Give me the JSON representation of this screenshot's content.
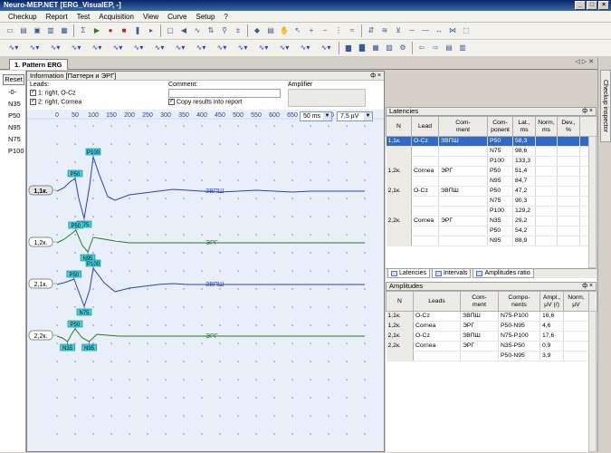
{
  "window": {
    "title": "Neuro-MEP.NET [ERG_VisualEP, -]",
    "min_glyph": "_",
    "max_glyph": "□",
    "close_glyph": "×"
  },
  "menu": [
    {
      "label": "Checkup"
    },
    {
      "label": "Report"
    },
    {
      "label": "Test"
    },
    {
      "label": "Acquisition"
    },
    {
      "label": "View"
    },
    {
      "label": "Curve"
    },
    {
      "label": "Setup"
    },
    {
      "label": "?"
    }
  ],
  "toolbar1_icons": [
    "new-icon",
    "open-icon",
    "save-icon",
    "print-icon",
    "preview-icon",
    "sigma-icon",
    "play-icon",
    "record-icon",
    "stop-icon",
    "pause-icon",
    "step-icon",
    "monitor-icon",
    "speaker-icon",
    "wave-icon",
    "arrows-icon",
    "search-icon",
    "gain-icon",
    "marker-icon",
    "lock-icon",
    "hand-icon",
    "cursor-icon",
    "zoom-in-icon",
    "zoom-out-icon",
    "split-icon",
    "average-icon",
    "invert-icon",
    "overlay-icon",
    "filter-icon",
    "smooth-icon",
    "baseline-icon",
    "shift-icon",
    "align-icon",
    "select-icon"
  ],
  "toolbar2_icons": [
    "curve1-icon",
    "curve2-icon",
    "curve3-icon",
    "curve4-icon",
    "curve5-icon",
    "curve6-icon",
    "curve7-icon",
    "curve8-icon",
    "curve9-icon",
    "curve10-icon",
    "curve11-icon",
    "curve12-icon",
    "curve13-icon",
    "curve14-icon",
    "curve15-icon",
    "curve16-icon",
    "histogram-icon",
    "bar-chart-icon",
    "table-icon",
    "photo-icon",
    "settings-icon",
    "back-icon",
    "forward-icon",
    "doc-icon",
    "report-icon"
  ],
  "doc_tab": {
    "label": "1. Pattern ERG",
    "controls": "◁ ▷ ✕"
  },
  "side_label": "Checkup inspector",
  "left": {
    "reset": "Reset",
    "rows": [
      "-0-",
      "N35",
      "P50",
      "N95",
      "N75",
      "P100"
    ]
  },
  "info": {
    "header": "Information [Паттерн и ЭРГ]",
    "pin": "ф ×",
    "leads_label": "Leads:",
    "leads": [
      {
        "text": "1: right, O-Cz",
        "checked": "✓"
      },
      {
        "text": "2: right, Cornea",
        "checked": "✓"
      }
    ],
    "comment_label": "Comment:",
    "copy_results": "Copy results into report",
    "copy_checked": "✓",
    "amplifier_label": "Amplifier"
  },
  "chart": {
    "time_scale": "50 ms",
    "amp_scale": "7,5 µV",
    "x_ticks": [
      0,
      50,
      100,
      150,
      200,
      250,
      300,
      350,
      400,
      450,
      500,
      550,
      600,
      650,
      700,
      750,
      800,
      850
    ],
    "traces": [
      {
        "tag": "1,1к.",
        "label": "ЗВПШ",
        "color": "#2a3fc0",
        "points": [
          [
            0,
            0
          ],
          [
            20,
            -4
          ],
          [
            35,
            -10
          ],
          [
            50,
            -14
          ],
          [
            60,
            8
          ],
          [
            75,
            30
          ],
          [
            90,
            -6
          ],
          [
            100,
            -38
          ],
          [
            115,
            -20
          ],
          [
            140,
            6
          ],
          [
            160,
            10
          ],
          [
            200,
            4
          ],
          [
            240,
            2
          ],
          [
            280,
            0
          ],
          [
            320,
            -2
          ],
          [
            360,
            -1
          ],
          [
            400,
            0
          ],
          [
            450,
            1
          ],
          [
            500,
            0
          ],
          [
            550,
            -1
          ],
          [
            600,
            0
          ],
          [
            650,
            1
          ],
          [
            700,
            0
          ],
          [
            750,
            0
          ],
          [
            800,
            0
          ],
          [
            850,
            0
          ]
        ],
        "markers": [
          {
            "name": "P50",
            "t": 50,
            "v": -14
          },
          {
            "name": "N75",
            "t": 75,
            "v": 30
          },
          {
            "name": "P100",
            "t": 100,
            "v": -38
          }
        ]
      },
      {
        "tag": "1,2к.",
        "label": "ЭРГ",
        "color": "#2a7a2a",
        "points": [
          [
            0,
            0
          ],
          [
            20,
            -4
          ],
          [
            40,
            -10
          ],
          [
            52,
            -14
          ],
          [
            70,
            3
          ],
          [
            85,
            10
          ],
          [
            100,
            -6
          ],
          [
            130,
            -4
          ],
          [
            160,
            -2
          ],
          [
            200,
            0
          ],
          [
            250,
            0
          ],
          [
            300,
            0
          ],
          [
            350,
            0
          ],
          [
            400,
            0
          ],
          [
            450,
            0
          ],
          [
            500,
            0
          ],
          [
            550,
            0
          ],
          [
            600,
            0
          ],
          [
            650,
            0
          ],
          [
            700,
            0
          ],
          [
            750,
            0
          ],
          [
            800,
            0
          ],
          [
            850,
            0
          ]
        ],
        "markers": [
          {
            "name": "P50",
            "t": 52,
            "v": -14
          },
          {
            "name": "N95",
            "t": 85,
            "v": 10
          }
        ]
      },
      {
        "tag": "2,1к.",
        "label": "ЗВПШ",
        "color": "#2a3fc0",
        "points": [
          [
            0,
            0
          ],
          [
            20,
            -2
          ],
          [
            35,
            -4
          ],
          [
            47,
            -6
          ],
          [
            60,
            8
          ],
          [
            75,
            24
          ],
          [
            90,
            6
          ],
          [
            100,
            -18
          ],
          [
            130,
            -2
          ],
          [
            160,
            8
          ],
          [
            200,
            4
          ],
          [
            240,
            2
          ],
          [
            280,
            0
          ],
          [
            320,
            -1
          ],
          [
            360,
            0
          ],
          [
            400,
            0
          ],
          [
            450,
            0
          ],
          [
            500,
            0
          ],
          [
            550,
            0
          ],
          [
            600,
            0
          ],
          [
            650,
            0
          ],
          [
            700,
            0
          ],
          [
            750,
            0
          ],
          [
            800,
            0
          ],
          [
            850,
            0
          ]
        ],
        "markers": [
          {
            "name": "P50",
            "t": 47,
            "v": -6
          },
          {
            "name": "N75",
            "t": 75,
            "v": 24
          },
          {
            "name": "P100",
            "t": 100,
            "v": -18
          }
        ]
      },
      {
        "tag": "2,2к.",
        "label": "ЭРГ",
        "color": "#2a7a2a",
        "points": [
          [
            0,
            0
          ],
          [
            15,
            2
          ],
          [
            29,
            6
          ],
          [
            40,
            -2
          ],
          [
            50,
            -8
          ],
          [
            70,
            2
          ],
          [
            89,
            6
          ],
          [
            110,
            -2
          ],
          [
            140,
            -1
          ],
          [
            170,
            0
          ],
          [
            200,
            0
          ],
          [
            250,
            0
          ],
          [
            300,
            0
          ],
          [
            350,
            0
          ],
          [
            400,
            0
          ],
          [
            450,
            0
          ],
          [
            500,
            0
          ],
          [
            550,
            0
          ],
          [
            600,
            0
          ],
          [
            650,
            0
          ],
          [
            700,
            0
          ],
          [
            750,
            0
          ],
          [
            800,
            0
          ],
          [
            850,
            0
          ]
        ],
        "markers": [
          {
            "name": "N35",
            "t": 29,
            "v": 6
          },
          {
            "name": "P50",
            "t": 50,
            "v": -8
          },
          {
            "name": "N95",
            "t": 89,
            "v": 6
          }
        ]
      }
    ]
  },
  "latencies": {
    "title": "Latencies",
    "pin": "ф ×",
    "headers": [
      "N",
      "Lead",
      "Com-\nment",
      "Com-\nponent",
      "Lat.,\nms",
      "Norm,\nms",
      "Dev.,\n%"
    ],
    "rows": [
      [
        "1,1к.",
        "O-Cz",
        "ЗВПШ",
        "P50",
        "58,3",
        "",
        ""
      ],
      [
        "",
        "",
        "",
        "N75",
        "98,6",
        "",
        ""
      ],
      [
        "",
        "",
        "",
        "P100",
        "133,3",
        "",
        ""
      ],
      [
        "1,2к.",
        "Cornea",
        "ЭРГ",
        "P50",
        "51,4",
        "",
        ""
      ],
      [
        "",
        "",
        "",
        "N95",
        "84,7",
        "",
        ""
      ],
      [
        "2,1к.",
        "O-Cz",
        "ЗВПШ",
        "P50",
        "47,2",
        "",
        ""
      ],
      [
        "",
        "",
        "",
        "N75",
        "90,3",
        "",
        ""
      ],
      [
        "",
        "",
        "",
        "P100",
        "129,2",
        "",
        ""
      ],
      [
        "2,2к.",
        "Cornea",
        "ЭРГ",
        "N35",
        "29,2",
        "",
        ""
      ],
      [
        "",
        "",
        "",
        "P50",
        "54,2",
        "",
        ""
      ],
      [
        "",
        "",
        "",
        "N95",
        "88,9",
        "",
        ""
      ]
    ],
    "tabs": [
      "Latencies",
      "Intervals",
      "Amplitudes ratio"
    ]
  },
  "amplitudes": {
    "title": "Amplitudes",
    "pin": "ф ×",
    "headers": [
      "N",
      "Leads",
      "Com-\nment",
      "Compo-\nnents",
      "Ampl.,\nµV (/)",
      "Norm,\nµV"
    ],
    "rows": [
      [
        "1,1к.",
        "O-Cz",
        "ЗВПШ",
        "N75-P100",
        "16,6",
        ""
      ],
      [
        "1,2к.",
        "Cornea",
        "ЭРГ",
        "P50-N95",
        "4,6",
        ""
      ],
      [
        "2,1к.",
        "O-Cz",
        "ЗВПШ",
        "N75-P100",
        "17,6",
        ""
      ],
      [
        "2,2к.",
        "Cornea",
        "ЭРГ",
        "N35-P50",
        "0,9",
        ""
      ],
      [
        "",
        "",
        "",
        "P50-N95",
        "3,9",
        ""
      ]
    ]
  }
}
